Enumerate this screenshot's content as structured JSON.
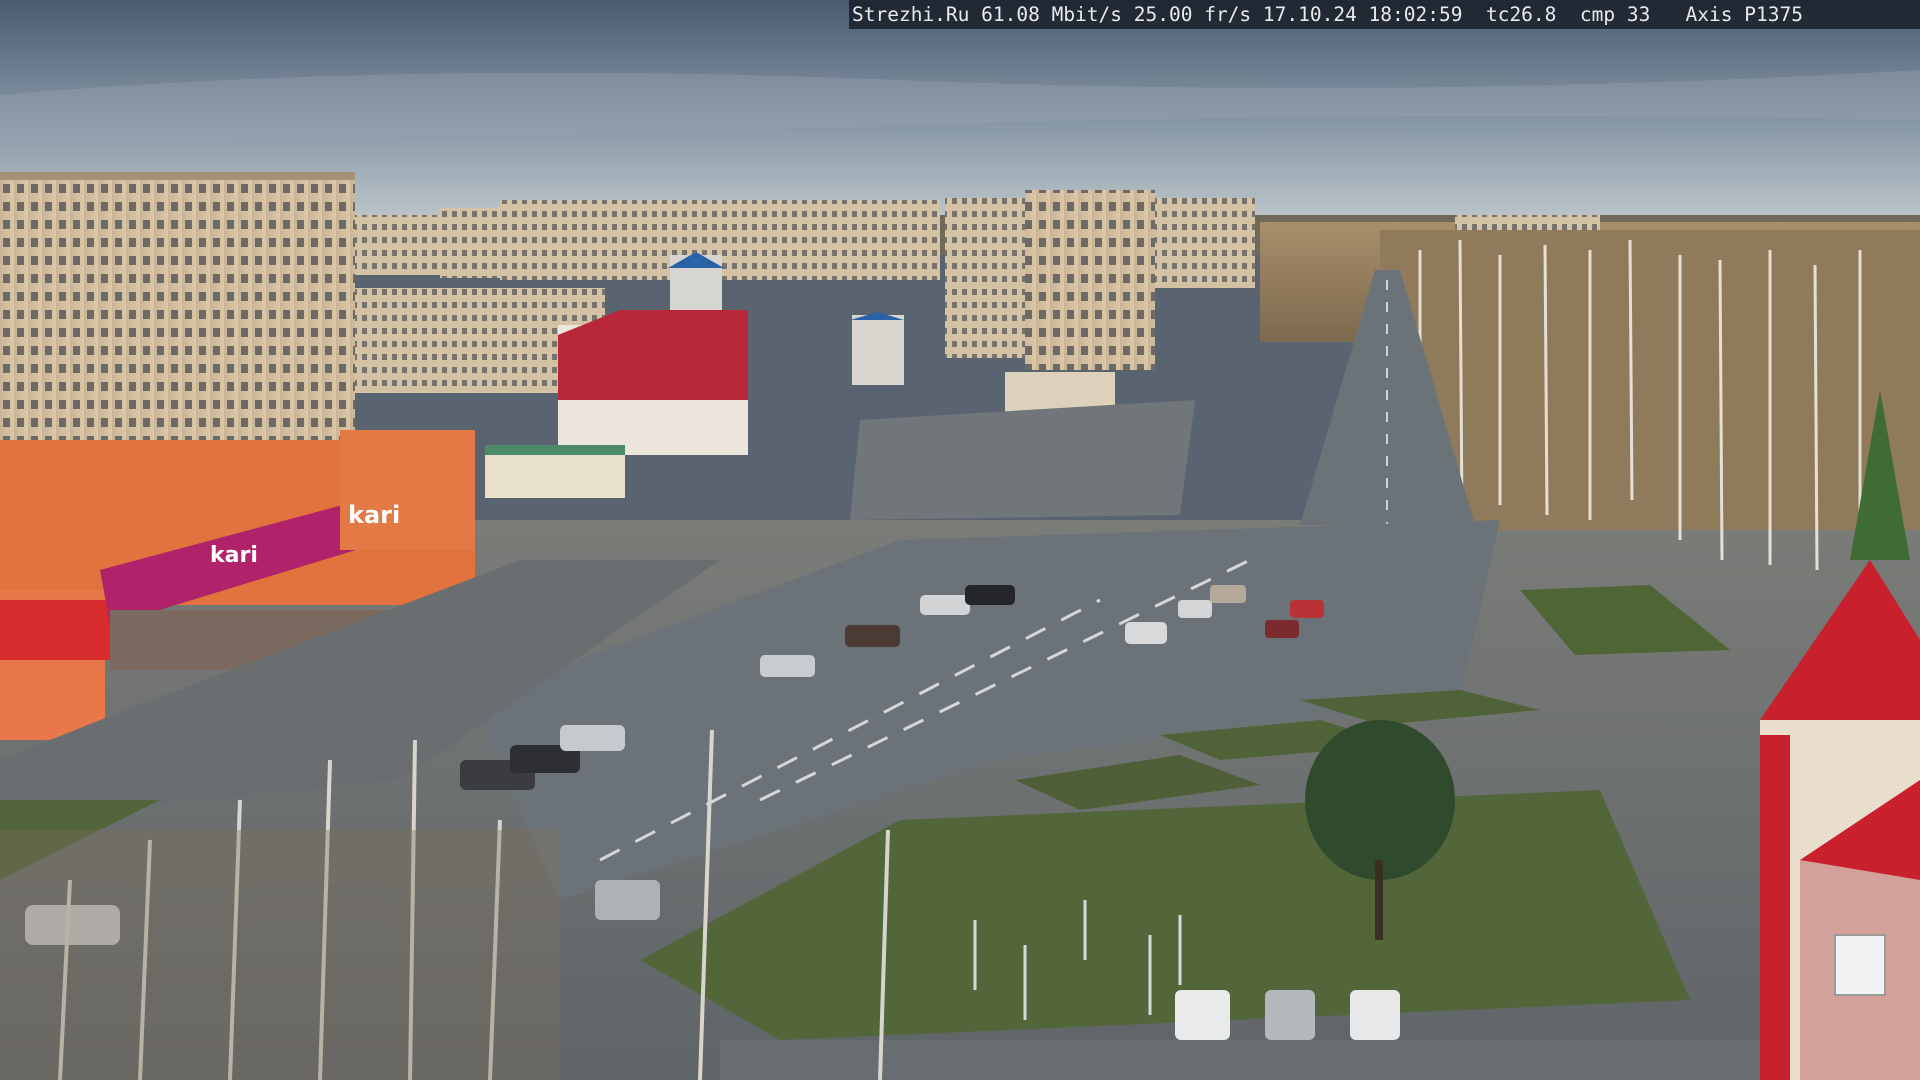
{
  "overlay": {
    "text": "Strezhi.Ru 61.08 Mbit/s 25.00 fr/s 17.10.24 18:02:59  tc26.8  cmp 33   Axis P1375"
  },
  "scene": {
    "store_sign": "kari",
    "store_sign_lower": "kari",
    "colors": {
      "sky_top": "#4e5e72",
      "sky_horizon": "#b9c3c9",
      "road": "#6e757b",
      "grass": "#55663a",
      "brand_magenta": "#b0226a",
      "tower_red": "#c8202c",
      "orange_building": "#e0703c"
    }
  }
}
